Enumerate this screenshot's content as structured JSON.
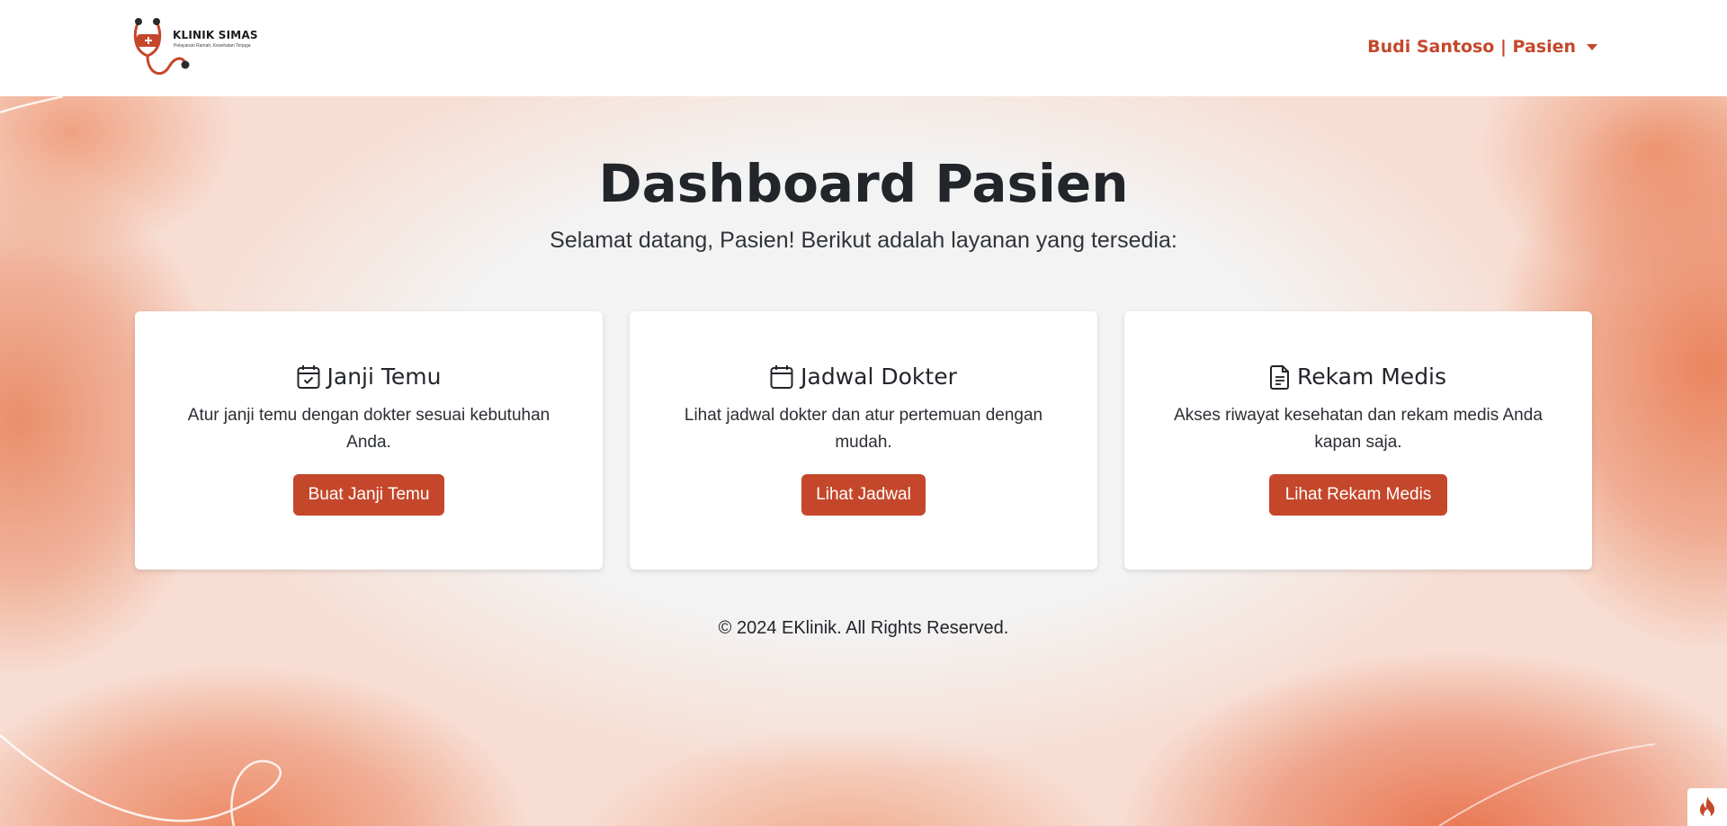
{
  "navbar": {
    "brand_name": "KLINIK SIMAS",
    "brand_tagline": "Pelayanan Ramah, Kesehatan Terjaga",
    "user_menu_label": "Budi Santoso | Pasien"
  },
  "header": {
    "title": "Dashboard Pasien",
    "subtitle": "Selamat datang, Pasien! Berikut adalah layanan yang tersedia:"
  },
  "cards": [
    {
      "icon": "calendar-check-icon",
      "title": "Janji Temu",
      "text": "Atur janji temu dengan dokter sesuai kebutuhan Anda.",
      "button_label": "Buat Janji Temu"
    },
    {
      "icon": "calendar-icon",
      "title": "Jadwal Dokter",
      "text": "Lihat jadwal dokter dan atur pertemuan dengan mudah.",
      "button_label": "Lihat Jadwal"
    },
    {
      "icon": "file-text-icon",
      "title": "Rekam Medis",
      "text": "Akses riwayat kesehatan dan rekam medis Anda kapan saja.",
      "button_label": "Lihat Rekam Medis"
    }
  ],
  "footer": {
    "copyright": "© 2024 EKlinik. All Rights Reserved."
  },
  "colors": {
    "accent": "#c5472b",
    "background_wash": "#ea8f6c",
    "card_bg": "#ffffff",
    "text_dark": "#22252a"
  }
}
